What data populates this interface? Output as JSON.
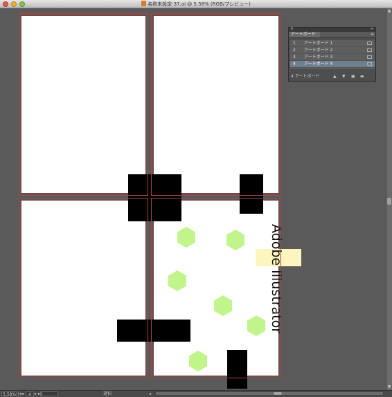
{
  "window": {
    "title": "名称未設定-37.ai @ 5.58% (RGB/プレビュー)"
  },
  "artwork": {
    "text": "Adobe Illustrator",
    "accent_colors": {
      "hexagon": "#bff58a",
      "highlight": "#fdf5be",
      "artboard_border": "#8b3a3a"
    }
  },
  "artboards_panel": {
    "tab_label": "アートボード",
    "menu_icon": "panel-menu-icon",
    "rows": [
      {
        "num": "1",
        "name": "アートボード 1",
        "selected": false
      },
      {
        "num": "2",
        "name": "アートボード 2",
        "selected": false
      },
      {
        "num": "3",
        "name": "アートボード 3",
        "selected": false
      },
      {
        "num": "4",
        "name": "アートボード 4",
        "selected": true
      }
    ],
    "footer_label": "4 アートボード"
  },
  "statusbar": {
    "zoom": "5.58%",
    "artboard": "4",
    "status_text": "選択"
  }
}
